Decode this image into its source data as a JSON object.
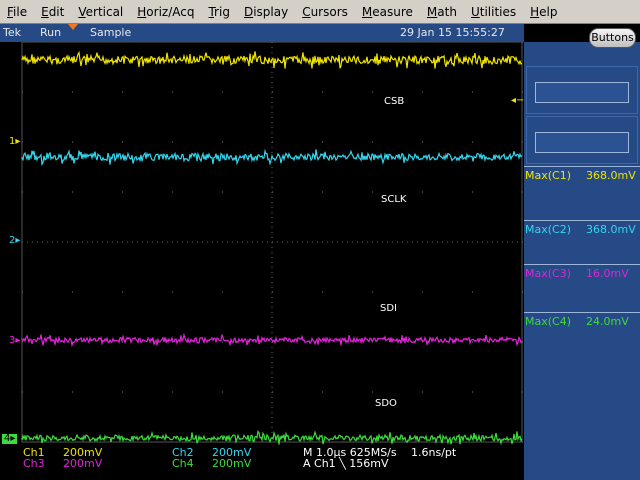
{
  "menu": [
    "File",
    "Edit",
    "Vertical",
    "Horiz/Acq",
    "Trig",
    "Display",
    "Cursors",
    "Measure",
    "Math",
    "Utilities",
    "Help"
  ],
  "status": {
    "brand": "Tek",
    "state": "Run",
    "mode": "Sample",
    "datetime": "29 Jan 15 15:55:27"
  },
  "buttons_label": "Buttons",
  "channels": {
    "c1": {
      "color": "#f0e400",
      "marker": "1",
      "label": "CSB"
    },
    "c2": {
      "color": "#33d6ee",
      "marker": "2",
      "label": "SCLK"
    },
    "c3": {
      "color": "#e024d8",
      "marker": "3",
      "label": "SDI"
    },
    "c4": {
      "color": "#3bdc3b",
      "marker": "4",
      "label": "SDO"
    }
  },
  "measurements": [
    {
      "label": "Max(C1)",
      "value": "368.0mV",
      "color": "#f0e400"
    },
    {
      "label": "Max(C2)",
      "value": "368.0mV",
      "color": "#33d6ee"
    },
    {
      "label": "Max(C3)",
      "value": "16.0mV",
      "color": "#e024d8"
    },
    {
      "label": "Max(C4)",
      "value": "24.0mV",
      "color": "#3bdc3b"
    }
  ],
  "readout": {
    "ch1": "Ch1",
    "ch1_scale": "200mV",
    "ch2": "Ch2",
    "ch2_scale": "200mV",
    "ch3": "Ch3",
    "ch3_scale": "200mV",
    "ch4": "Ch4",
    "ch4_scale": "200mV",
    "timebase": "M 1.0µs 625MS/s",
    "resolution": "1.6ns/pt",
    "trigger": "A  Ch1  ╲  156mV"
  }
}
